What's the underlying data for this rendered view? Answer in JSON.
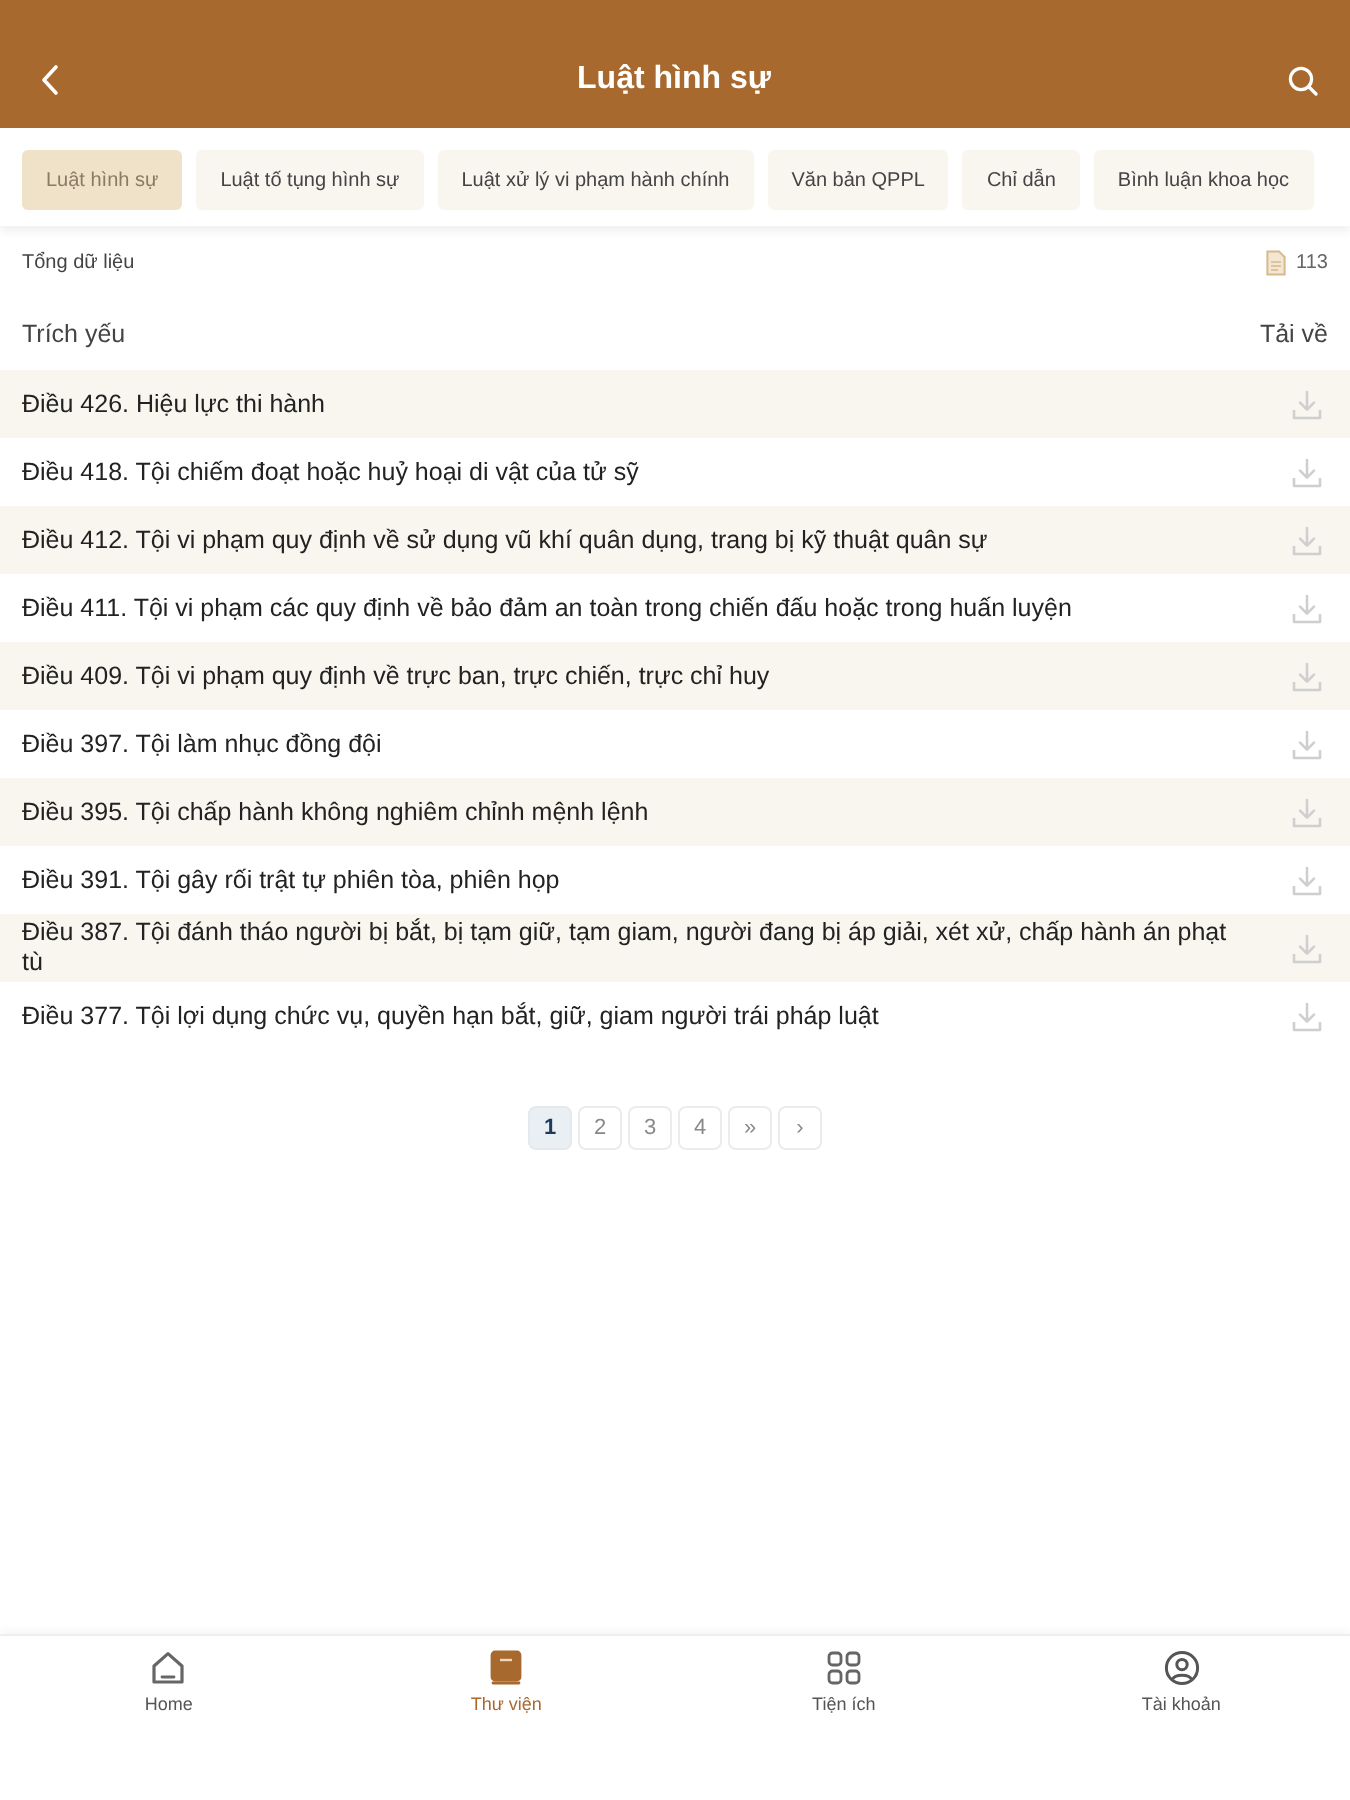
{
  "header": {
    "title": "Luật hình sự"
  },
  "tabs": [
    {
      "label": "Luật hình sự",
      "selected": true
    },
    {
      "label": "Luật tố tụng hình sự",
      "selected": false
    },
    {
      "label": "Luật xử lý vi phạm hành chính",
      "selected": false
    },
    {
      "label": "Văn bản QPPL",
      "selected": false
    },
    {
      "label": "Chỉ dẫn",
      "selected": false
    },
    {
      "label": "Bình luận khoa học",
      "selected": false
    }
  ],
  "summary": {
    "label": "Tổng dữ liệu",
    "count": "113"
  },
  "table": {
    "columns": [
      "Trích yếu",
      "Tải về"
    ],
    "rows": [
      {
        "title": "Điều 426. Hiệu lực thi hành"
      },
      {
        "title": "Điều 418. Tội chiếm đoạt hoặc huỷ hoại di vật của tử sỹ"
      },
      {
        "title": "Điều 412. Tội vi phạm quy định về sử dụng vũ khí quân dụng, trang bị kỹ thuật quân sự"
      },
      {
        "title": "Điều 411. Tội vi phạm các quy định về bảo đảm an toàn trong chiến đấu hoặc trong huấn luyện"
      },
      {
        "title": "Điều 409. Tội vi phạm quy định về trực ban, trực chiến, trực chỉ huy"
      },
      {
        "title": "Điều 397. Tội làm nhục đồng đội"
      },
      {
        "title": "Điều 395. Tội chấp hành không nghiêm chỉnh mệnh lệnh"
      },
      {
        "title": "Điều 391. Tội gây rối trật tự phiên tòa, phiên họp"
      },
      {
        "title": "Điều 387. Tội đánh tháo người bị bắt, bị tạm giữ, tạm giam, người đang bị áp giải, xét xử, chấp hành án phạt tù"
      },
      {
        "title": "Điều 377. Tội lợi dụng chức vụ, quyền hạn bắt, giữ, giam người trái pháp luật"
      }
    ]
  },
  "pagination": [
    {
      "label": "1",
      "selected": true
    },
    {
      "label": "2",
      "selected": false
    },
    {
      "label": "3",
      "selected": false
    },
    {
      "label": "4",
      "selected": false
    },
    {
      "label": "»",
      "selected": false
    },
    {
      "label": "›",
      "selected": false
    }
  ],
  "bottom_nav": [
    {
      "label": "Home",
      "kind": "home",
      "selected": false
    },
    {
      "label": "Thư viện",
      "kind": "library",
      "selected": true
    },
    {
      "label": "Tiện ích",
      "kind": "utilities",
      "selected": false
    },
    {
      "label": "Tài khoản",
      "kind": "account",
      "selected": false
    }
  ]
}
